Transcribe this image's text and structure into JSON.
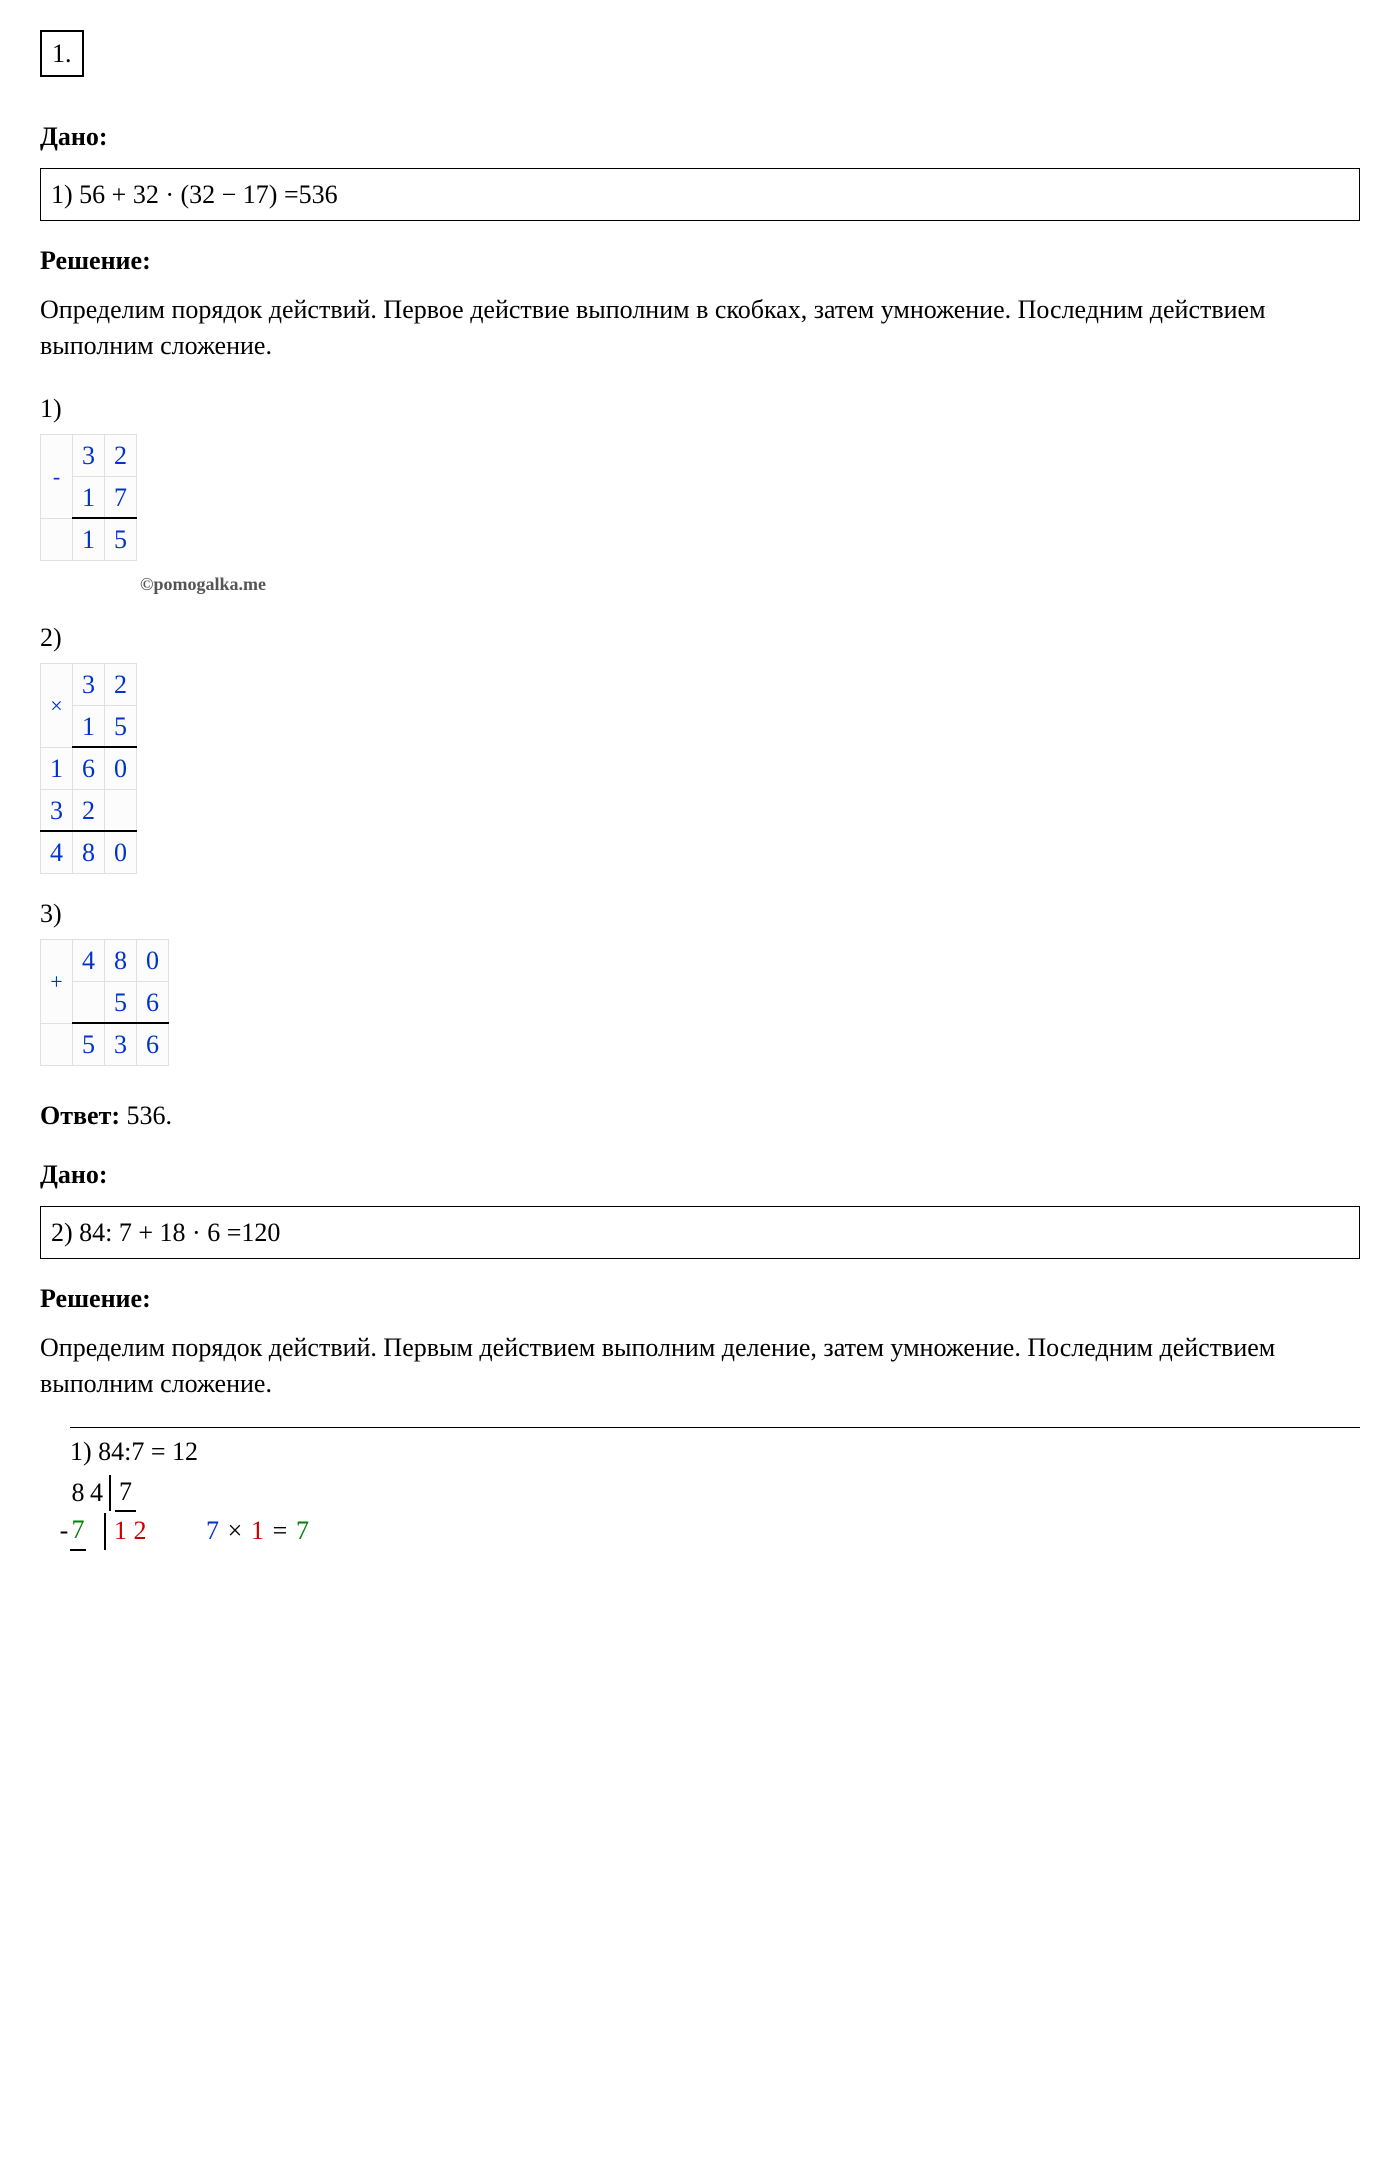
{
  "problem_number": "1.",
  "section1": {
    "given_label": "Дано:",
    "given_expression": "1) 56 + 32 · (32 − 17) =536",
    "solution_label": "Решение:",
    "solution_text": "Определим порядок действий. Первое действие выполним в скобках, затем умножение. Последним действием выполним сложение.",
    "step1_label": "1)",
    "calc1": {
      "op": "-",
      "row1": [
        "",
        "3",
        "2"
      ],
      "row2": [
        "",
        "1",
        "7"
      ],
      "result": [
        "",
        "1",
        "5"
      ]
    },
    "watermark": "©pomogalka.me",
    "step2_label": "2)",
    "calc2": {
      "op": "×",
      "row1": [
        "3",
        "2"
      ],
      "row2": [
        "1",
        "5"
      ],
      "partial1": [
        "1",
        "6",
        "0"
      ],
      "partial2": [
        "3",
        "2",
        ""
      ],
      "result": [
        "4",
        "8",
        "0"
      ]
    },
    "step3_label": "3)",
    "calc3": {
      "op": "+",
      "row1": [
        "",
        "4",
        "8",
        "0"
      ],
      "row2": [
        "",
        "",
        "5",
        "6"
      ],
      "result": [
        "",
        "5",
        "3",
        "6"
      ]
    },
    "answer_label": "Ответ:",
    "answer_value": "536."
  },
  "section2": {
    "given_label": "Дано:",
    "given_expression": "2) 84: 7 + 18 · 6 =120",
    "solution_label": "Решение:",
    "solution_text": "Определим порядок действий. Первым действием выполним деление, затем умножение. Последним действием выполним сложение.",
    "division": {
      "header": "1) 84:7 = 12",
      "dividend": [
        "8",
        "4"
      ],
      "divisor": "7",
      "sub1": "7",
      "quotient": "1 2",
      "hint": "7 × 1 = 7",
      "hint_parts": {
        "a": "7",
        "op": "×",
        "b": "1",
        "eq": "=",
        "r": "7"
      }
    }
  }
}
